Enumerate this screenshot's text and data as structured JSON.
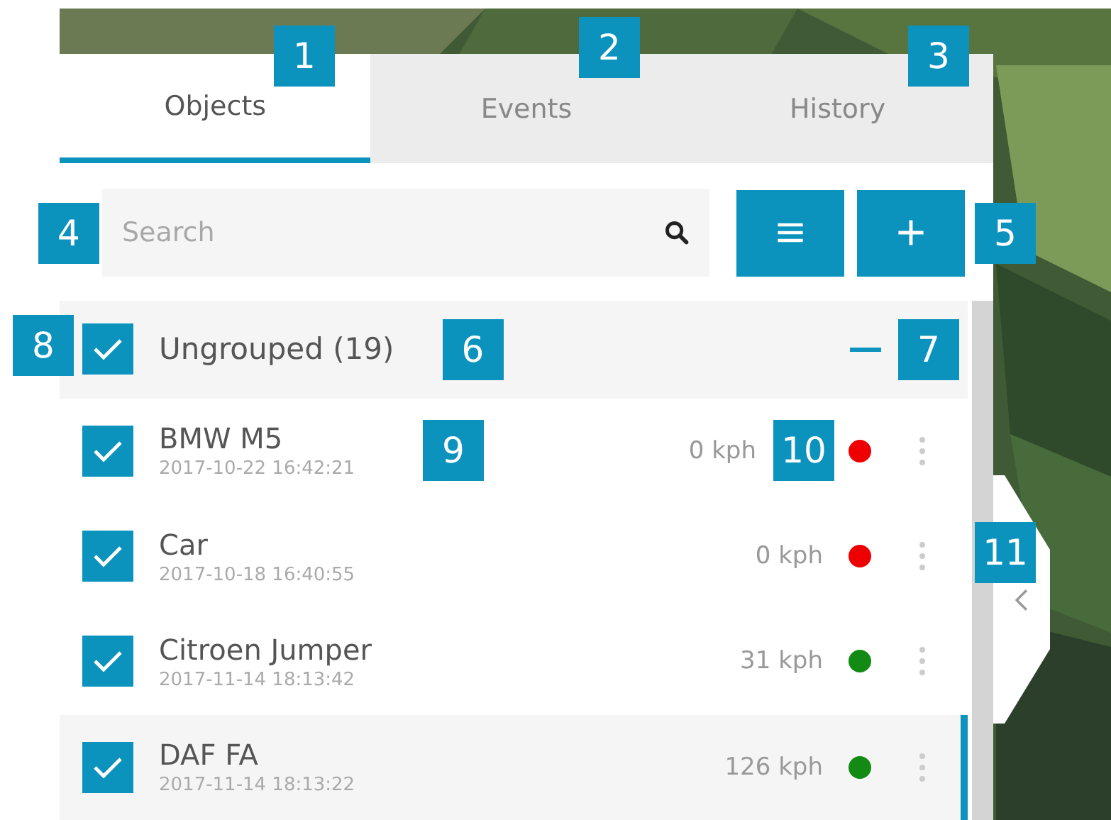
{
  "tabs": [
    {
      "label": "Objects",
      "selected": true
    },
    {
      "label": "Events",
      "selected": false
    },
    {
      "label": "History",
      "selected": false
    }
  ],
  "search": {
    "placeholder": "Search"
  },
  "group": {
    "title": "Ungrouped (19)",
    "title_callout": "6",
    "checked": true,
    "expanded": true,
    "toggle_callout": "7"
  },
  "objects": [
    {
      "name": "BMW M5",
      "time": "2017-10-22 16:42:21",
      "name_callout": "9",
      "speed": "0 kph",
      "speed_callout": "10",
      "color": "#ee0000",
      "checked": true,
      "selected": false
    },
    {
      "name": "Car",
      "time": "2017-10-18 16:40:55",
      "speed": "0 kph",
      "color": "#ee0000",
      "checked": true,
      "selected": false
    },
    {
      "name": "Citroen Jumper",
      "time": "2017-11-14 18:13:42",
      "speed": "31 kph",
      "color": "#138a13",
      "checked": true,
      "selected": false
    },
    {
      "name": "DAF FA",
      "time": "2017-11-14 18:13:22",
      "speed": "126 kph",
      "color": "#138a13",
      "checked": true,
      "selected": true
    }
  ],
  "callouts": [
    "1",
    "2",
    "3",
    "4",
    "5",
    "8",
    "11"
  ]
}
